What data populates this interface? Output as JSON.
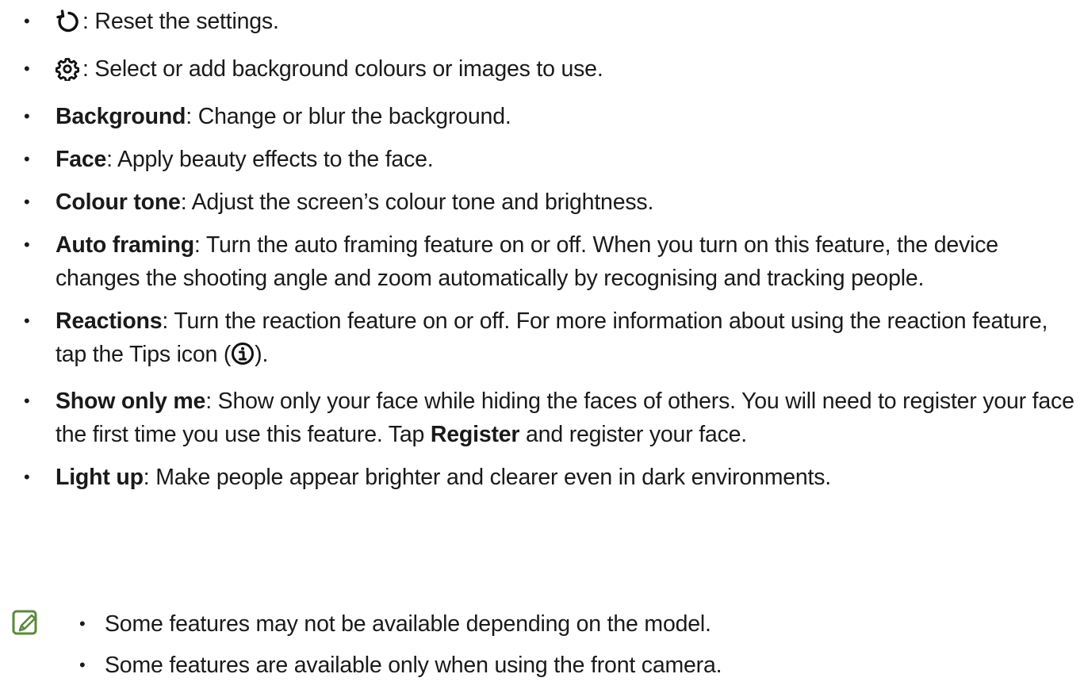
{
  "items": [
    {
      "icon": "reset-icon",
      "text": ": Reset the settings."
    },
    {
      "icon": "gear-icon",
      "text": ": Select or add background colours or images to use."
    },
    {
      "term": "Background",
      "text": ": Change or blur the background."
    },
    {
      "term": "Face",
      "text": ": Apply beauty effects to the face."
    },
    {
      "term": "Colour tone",
      "text": ": Adjust the screen’s colour tone and brightness."
    },
    {
      "term": "Auto framing",
      "text": ": Turn the auto framing feature on or off. When you turn on this feature, the device changes the shooting angle and zoom automatically by recognising and tracking people."
    },
    {
      "term": "Reactions",
      "text": ": Turn the reaction feature on or off. For more information about using the reaction feature, tap the Tips icon (",
      "icon_after": "info-icon",
      "text_after": ")."
    },
    {
      "term": "Show only me",
      "text": ": Show only your face while hiding the faces of others. You will need to register your face the first time you use this feature. Tap ",
      "term2": "Register",
      "text2": " and register your face."
    },
    {
      "term": "Light up",
      "text": ": Make people appear brighter and clearer even in dark environments."
    }
  ],
  "note": {
    "icon": "note-icon",
    "accent_color": "#5a8a3a",
    "items": [
      "Some features may not be available depending on the model.",
      "Some features are available only when using the front camera."
    ]
  }
}
